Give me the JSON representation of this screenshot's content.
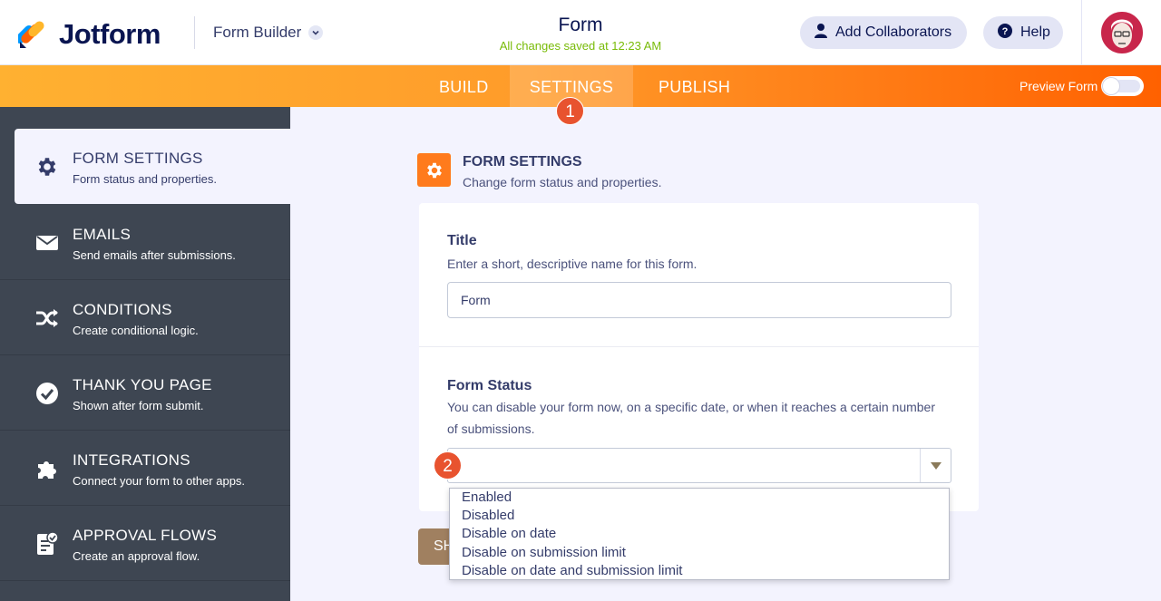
{
  "header": {
    "brand": "Jotform",
    "builder_label": "Form Builder",
    "form_title": "Form",
    "saved_status": "All changes saved at 12:23 AM",
    "collab_label": "Add Collaborators",
    "help_label": "Help"
  },
  "tabs": {
    "build": "BUILD",
    "settings": "SETTINGS",
    "publish": "PUBLISH",
    "active": "SETTINGS"
  },
  "preview_label": "Preview Form",
  "step_badges": [
    "1",
    "2"
  ],
  "sidebar": {
    "items": [
      {
        "title": "FORM SETTINGS",
        "sub": "Form status and properties.",
        "icon": "gear-icon",
        "active": true
      },
      {
        "title": "EMAILS",
        "sub": "Send emails after submissions.",
        "icon": "envelope-icon"
      },
      {
        "title": "CONDITIONS",
        "sub": "Create conditional logic.",
        "icon": "shuffle-icon"
      },
      {
        "title": "THANK YOU PAGE",
        "sub": "Shown after form submit.",
        "icon": "check-circle-icon"
      },
      {
        "title": "INTEGRATIONS",
        "sub": "Connect your form to other apps.",
        "icon": "puzzle-icon"
      },
      {
        "title": "APPROVAL FLOWS",
        "sub": "Create an approval flow.",
        "icon": "approval-icon"
      }
    ]
  },
  "main": {
    "section_title": "FORM SETTINGS",
    "section_sub": "Change form status and properties.",
    "title_label": "Title",
    "title_desc": "Enter a short, descriptive name for this form.",
    "title_value": "Form",
    "status_label": "Form Status",
    "status_desc_1": "You can disable your form now, on a specific date, or when it reaches a certain number",
    "status_desc_2": "of submissions.",
    "status_value": "",
    "save_button": "SH"
  },
  "status_options": [
    "Enabled",
    "Disabled",
    "Disable on date",
    "Disable on submission limit",
    "Disable on date and submission limit"
  ],
  "colors": {
    "accent_orange": "#ff7b1c",
    "sidebar_bg": "#3e4652",
    "saved_green": "#78bb07",
    "badge_red": "#e8532f"
  }
}
